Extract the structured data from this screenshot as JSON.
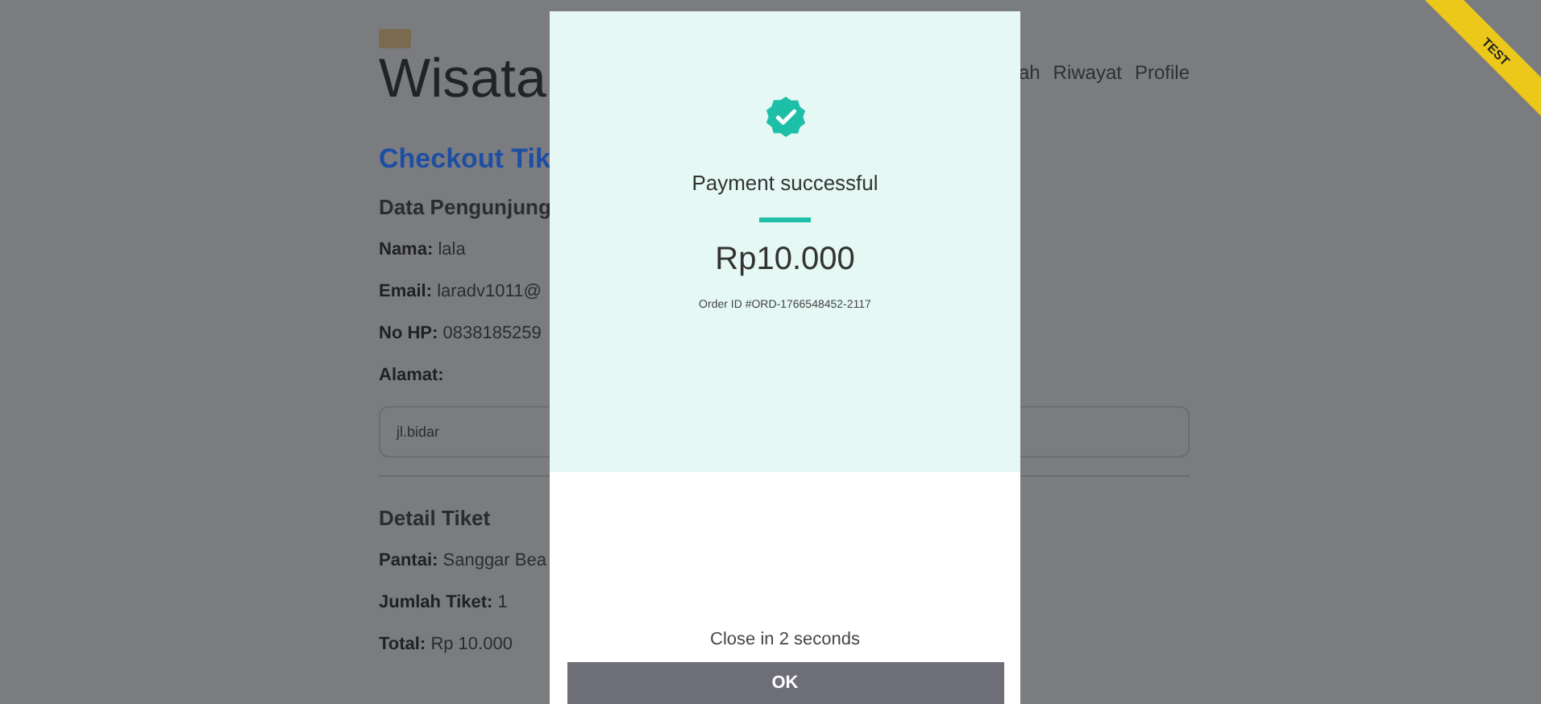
{
  "header": {
    "brand": "Wisata",
    "nav": [
      "ah",
      "Riwayat",
      "Profile"
    ]
  },
  "checkout": {
    "title": "Checkout Tik",
    "visitor_heading": "Data Pengunjung",
    "fields": [
      {
        "label": "Nama:",
        "value": "lala"
      },
      {
        "label": "Email:",
        "value": "laradv1011@"
      },
      {
        "label": "No HP:",
        "value": "0838185259"
      }
    ],
    "address_label": "Alamat:",
    "address_value": "jl.bidar",
    "ticket_heading": "Detail Tiket",
    "ticket_fields": [
      {
        "label": "Pantai:",
        "value": "Sanggar Bea"
      },
      {
        "label": "Jumlah Tiket:",
        "value": "1"
      },
      {
        "label": "Total:",
        "value": "Rp 10.000"
      }
    ]
  },
  "modal": {
    "title": "Payment successful",
    "amount": "Rp10.000",
    "order_id": "Order ID #ORD-1766548452-2117",
    "countdown": "Close in 2 seconds",
    "button": "OK"
  },
  "ribbon": "TEST"
}
